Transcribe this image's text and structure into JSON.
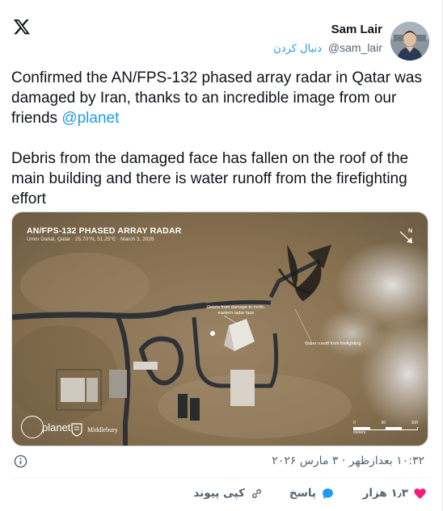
{
  "header": {
    "author_name": "Sam Lair",
    "follow_label": "دنبال کردن",
    "handle": "@sam_lair"
  },
  "tweet": {
    "paragraph1_text": "Confirmed the AN/FPS-132 phased array radar in Qatar was damaged by Iran, thanks to an incredible image from our friends",
    "mention": "@planet",
    "paragraph2": "Debris from the damaged face has fallen on the roof of the main building and there is water runoff from the firefighting effort"
  },
  "media": {
    "title": "AN/FPS-132 PHASED ARRAY RADAR",
    "subtitle": "Umm Dahal, Qatar · 25.70°N, 51.25°E · March 3, 2026",
    "annotation_debris": "Debris from damage to north-eastern radar face",
    "annotation_water": "Water runoff from firefighting",
    "north_label": "N",
    "planet_brand": "planet.",
    "middlebury_brand": "Middlebury",
    "scale_labels": [
      "0",
      "50",
      "100"
    ],
    "scale_unit": "meters"
  },
  "meta": {
    "timestamp": "۱۰:۳۲ بعدازظهر · ۳ مارس ۲۰۲۶"
  },
  "actions": {
    "like_count": "۱٫۳ هزار",
    "reply_label": "پاسخ",
    "copy_link_label": "کپی پیوند"
  },
  "colors": {
    "accent": "#1d9bf0",
    "like": "#f91880",
    "secondary_text": "#536471"
  }
}
